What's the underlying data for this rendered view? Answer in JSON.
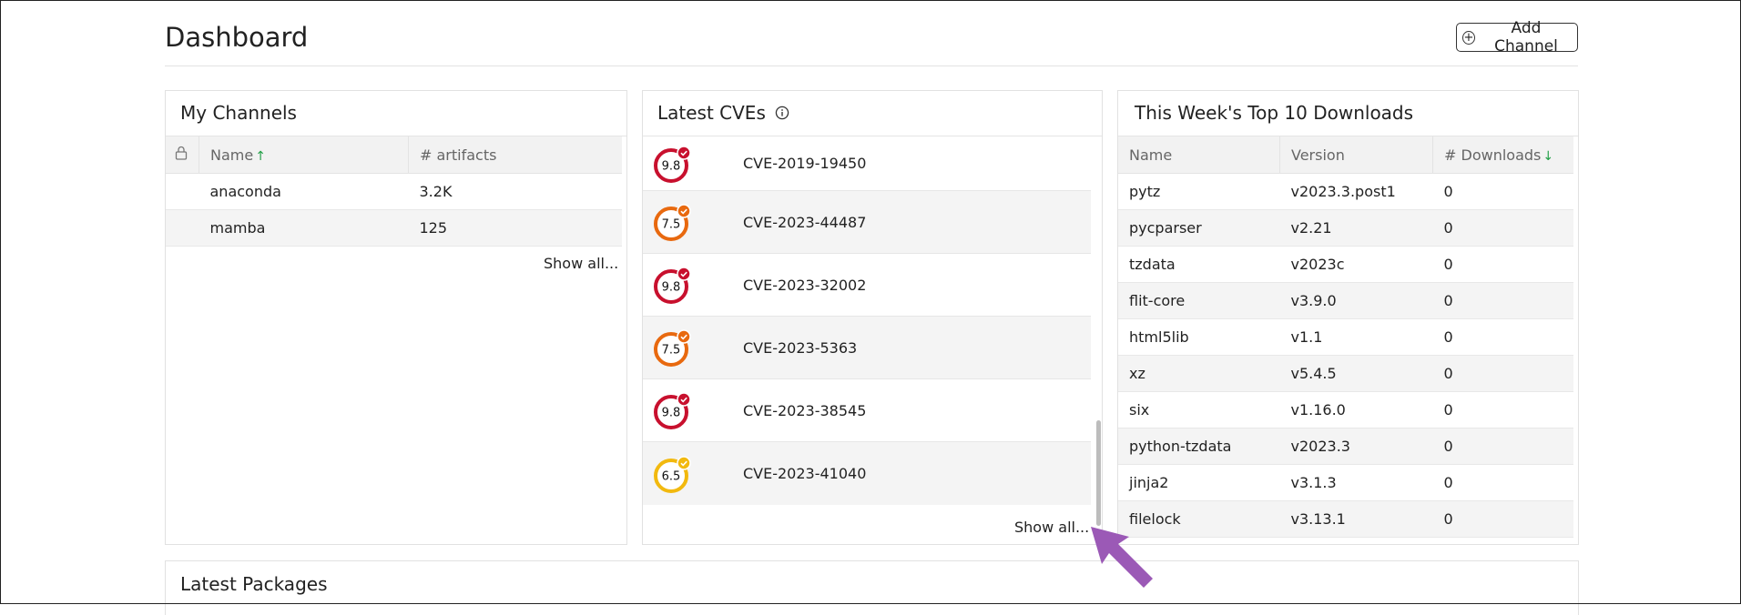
{
  "header": {
    "title": "Dashboard",
    "add_channel_label": "Add Channel"
  },
  "my_channels": {
    "title": "My Channels",
    "columns": {
      "name": "Name",
      "artifacts": "# artifacts"
    },
    "rows": [
      {
        "name": "anaconda",
        "artifacts": "3.2K"
      },
      {
        "name": "mamba",
        "artifacts": "125"
      }
    ],
    "show_all": "Show all..."
  },
  "latest_cves": {
    "title": "Latest CVEs",
    "items": [
      {
        "score": "9.8",
        "id": "CVE-2019-19450",
        "color": "#c8102e"
      },
      {
        "score": "7.5",
        "id": "CVE-2023-44487",
        "color": "#e8690f"
      },
      {
        "score": "9.8",
        "id": "CVE-2023-32002",
        "color": "#c8102e"
      },
      {
        "score": "7.5",
        "id": "CVE-2023-5363",
        "color": "#e8690f"
      },
      {
        "score": "9.8",
        "id": "CVE-2023-38545",
        "color": "#c8102e"
      },
      {
        "score": "6.5",
        "id": "CVE-2023-41040",
        "color": "#f2b90f"
      }
    ],
    "show_all": "Show all..."
  },
  "top_downloads": {
    "title": "This Week's Top 10 Downloads",
    "columns": {
      "name": "Name",
      "version": "Version",
      "downloads": "# Downloads"
    },
    "rows": [
      {
        "name": "pytz",
        "version": "v2023.3.post1",
        "downloads": "0"
      },
      {
        "name": "pycparser",
        "version": "v2.21",
        "downloads": "0"
      },
      {
        "name": "tzdata",
        "version": "v2023c",
        "downloads": "0"
      },
      {
        "name": "flit-core",
        "version": "v3.9.0",
        "downloads": "0"
      },
      {
        "name": "html5lib",
        "version": "v1.1",
        "downloads": "0"
      },
      {
        "name": "xz",
        "version": "v5.4.5",
        "downloads": "0"
      },
      {
        "name": "six",
        "version": "v1.16.0",
        "downloads": "0"
      },
      {
        "name": "python-tzdata",
        "version": "v2023.3",
        "downloads": "0"
      },
      {
        "name": "jinja2",
        "version": "v3.1.3",
        "downloads": "0"
      },
      {
        "name": "filelock",
        "version": "v3.13.1",
        "downloads": "0"
      }
    ]
  },
  "latest_packages": {
    "title": "Latest Packages"
  },
  "colors": {
    "accent_sort": "#22a047",
    "annotation_arrow": "#9b59b6"
  }
}
